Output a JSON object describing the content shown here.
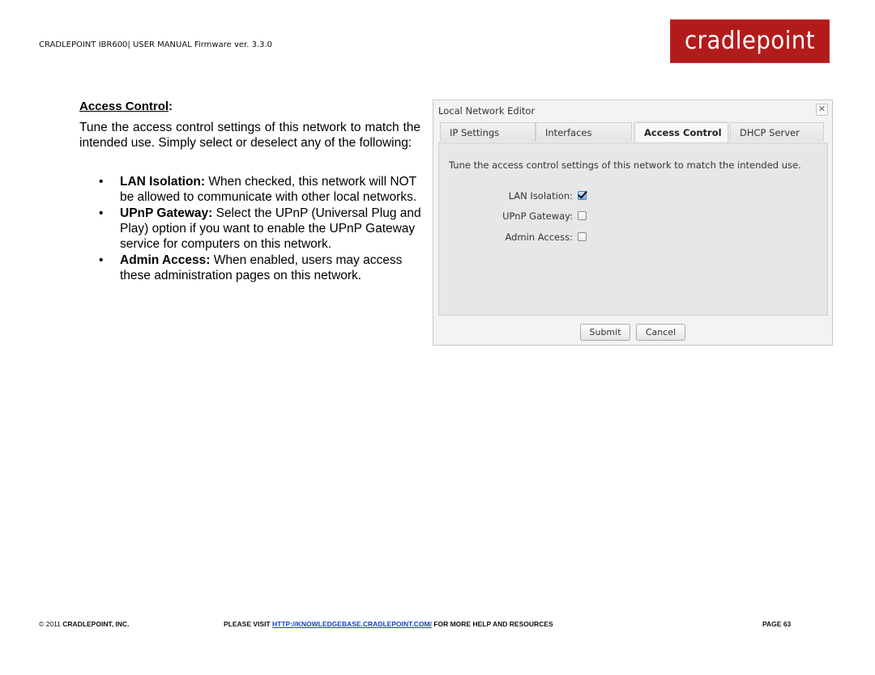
{
  "header": {
    "manual_title": "CRADLEPOINT IBR600| USER MANUAL Firmware ver. 3.3.0",
    "logo_text": "cradlepoint",
    "brand_color": "#b31b1b"
  },
  "section": {
    "heading": "Access Control",
    "heading_suffix": ":",
    "intro": "Tune the access control settings of this network to match the intended use. Simply select or deselect any of the following:",
    "bullets": [
      {
        "term": "LAN Isolation:",
        "text": " When checked, this network will NOT be allowed to communicate with other local networks."
      },
      {
        "term": "UPnP Gateway:",
        "text": " Select the UPnP (Universal Plug and Play) option if you want to enable the UPnP Gateway service for computers on this network."
      },
      {
        "term": "Admin Access:",
        "text": " When enabled, users may access these administration pages on this network."
      }
    ]
  },
  "dialog": {
    "title": "Local Network Editor",
    "close_icon": "close-icon",
    "tabs": [
      {
        "label": "IP Settings",
        "active": false
      },
      {
        "label": "Interfaces",
        "active": false
      },
      {
        "label": "Access Control",
        "active": true
      },
      {
        "label": "DHCP Server",
        "active": false
      }
    ],
    "description": "Tune the access control settings of this network to match the intended use.",
    "fields": [
      {
        "label": "LAN Isolation:",
        "checked": true
      },
      {
        "label": "UPnP Gateway:",
        "checked": false
      },
      {
        "label": "Admin Access:",
        "checked": false
      }
    ],
    "submit_label": "Submit",
    "cancel_label": "Cancel"
  },
  "footer": {
    "copyright": "© 2011 ",
    "company": "CRADLEPOINT, INC.",
    "visit_prefix": "PLEASE VISIT ",
    "link_text": "HTTP://KNOWLEDGEBASE.CRADLEPOINT.COM/",
    "visit_suffix": " FOR MORE HELP AND RESOURCES",
    "page": "PAGE 63",
    "link_color": "#1a3fd1"
  }
}
